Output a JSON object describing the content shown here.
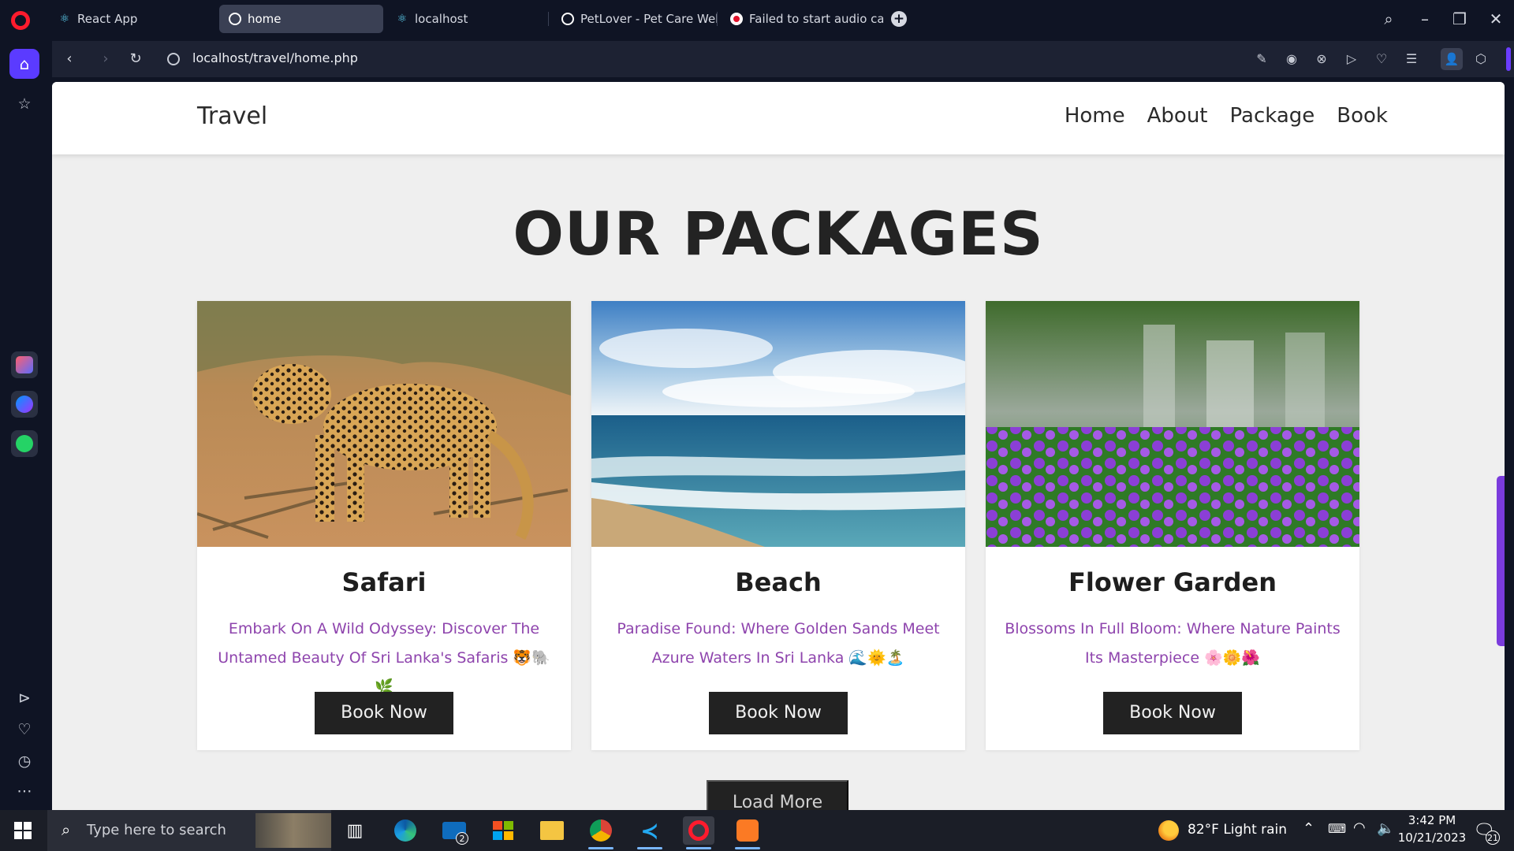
{
  "browser": {
    "tabs": [
      {
        "label": "React App",
        "icon": "react-icon",
        "active": false
      },
      {
        "label": "home",
        "icon": "globe-icon",
        "active": true
      },
      {
        "label": "localhost",
        "icon": "react-icon",
        "active": false
      },
      {
        "label": "PetLover - Pet Care Websi",
        "icon": "globe-icon",
        "active": false
      },
      {
        "label": "Failed to start audio captu",
        "icon": "record-icon",
        "active": false
      }
    ],
    "url": "localhost/travel/home.php",
    "accent_color": "#5b3bff"
  },
  "site": {
    "logo": "Travel",
    "nav": [
      "Home",
      "About",
      "Package",
      "Book"
    ],
    "section_title": "OUR PACKAGES",
    "packages": [
      {
        "title": "Safari",
        "description": "Embark On A Wild Odyssey: Discover The Untamed Beauty Of Sri Lanka's Safaris 🐯🐘🌿",
        "button": "Book Now",
        "image": "leopard-photo"
      },
      {
        "title": "Beach",
        "description": "Paradise Found: Where Golden Sands Meet Azure Waters In Sri Lanka 🌊🌞🏝️",
        "button": "Book Now",
        "image": "beach-photo"
      },
      {
        "title": "Flower Garden",
        "description": "Blossoms In Full Bloom: Where Nature Paints Its Masterpiece 🌸🌼🌺",
        "button": "Book Now",
        "image": "flowers-photo"
      }
    ],
    "load_more": "Load More",
    "text_color": "#8e44ad"
  },
  "taskbar": {
    "search_placeholder": "Type here to search",
    "mail_badge": "2",
    "weather": "82°F  Light rain",
    "time": "3:42 PM",
    "date": "10/21/2023",
    "notification_count": "21"
  }
}
